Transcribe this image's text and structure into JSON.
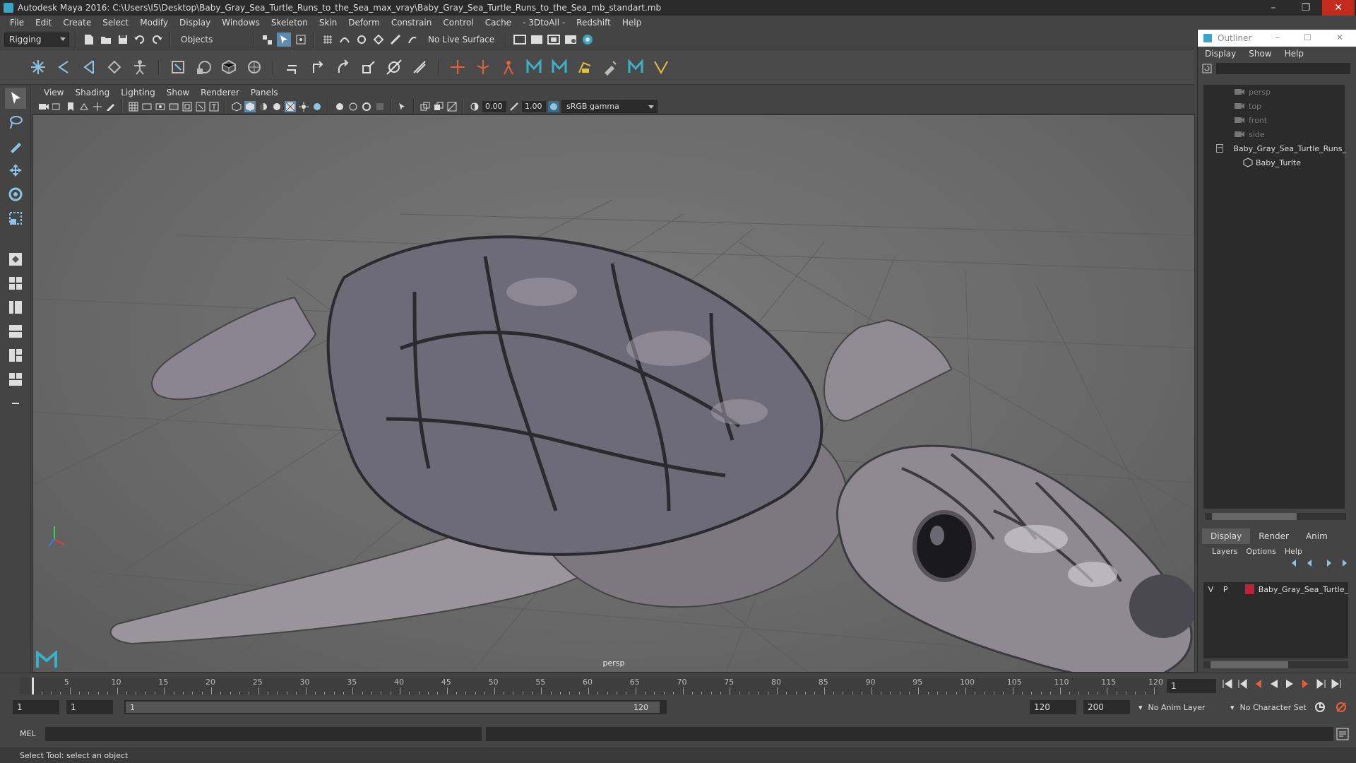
{
  "window": {
    "title": "Autodesk Maya 2016: C:\\Users\\I5\\Desktop\\Baby_Gray_Sea_Turtle_Runs_to_the_Sea_max_vray\\Baby_Gray_Sea_Turtle_Runs_to_the_Sea_mb_standart.mb",
    "minimize": "–",
    "restore": "❐",
    "close": "✕"
  },
  "menubar": [
    "File",
    "Edit",
    "Create",
    "Select",
    "Modify",
    "Display",
    "Windows",
    "Skeleton",
    "Skin",
    "Deform",
    "Constrain",
    "Control",
    "Cache",
    "- 3DtoAll -",
    "Redshift",
    "Help"
  ],
  "statusline": {
    "menuset": "Rigging",
    "select_mode": "Objects",
    "live_surface": "No Live Surface"
  },
  "viewport": {
    "menu": [
      "View",
      "Shading",
      "Lighting",
      "Show",
      "Renderer",
      "Panels"
    ],
    "exposure": "0.00",
    "gamma": "1.00",
    "color_space": "sRGB gamma",
    "camera": "persp"
  },
  "outliner": {
    "title": "Outliner",
    "menu": [
      "Display",
      "Show",
      "Help"
    ],
    "items": [
      {
        "label": "persp",
        "dim": true,
        "indent": 0
      },
      {
        "label": "top",
        "dim": true,
        "indent": 0
      },
      {
        "label": "front",
        "dim": true,
        "indent": 0
      },
      {
        "label": "side",
        "dim": true,
        "indent": 0
      },
      {
        "label": "Baby_Gray_Sea_Turtle_Runs_",
        "dim": false,
        "indent": 0
      },
      {
        "label": "Baby_Turlte",
        "dim": false,
        "indent": 1
      }
    ]
  },
  "layer_editor": {
    "tabs": [
      "Display",
      "Render",
      "Anim"
    ],
    "menu": [
      "Layers",
      "Options",
      "Help"
    ],
    "layer": {
      "v": "V",
      "p": "P",
      "name": "Baby_Gray_Sea_Turtle_",
      "color": "#c0203a"
    }
  },
  "timeline": {
    "ticks": [
      5,
      10,
      15,
      20,
      25,
      30,
      35,
      40,
      45,
      50,
      55,
      60,
      65,
      70,
      75,
      80,
      85,
      90,
      95,
      100,
      105,
      110,
      115,
      120
    ],
    "current_frame_field": "1",
    "current_frame": 1
  },
  "range": {
    "start": "1",
    "start_inner": "1",
    "slider_start": "1",
    "slider_end": "120",
    "end": "120",
    "end_outer": "200",
    "anim_layer": "No Anim Layer",
    "character_set": "No Character Set"
  },
  "cmdline": {
    "label": "MEL"
  },
  "helpline": "Select Tool: select an object"
}
